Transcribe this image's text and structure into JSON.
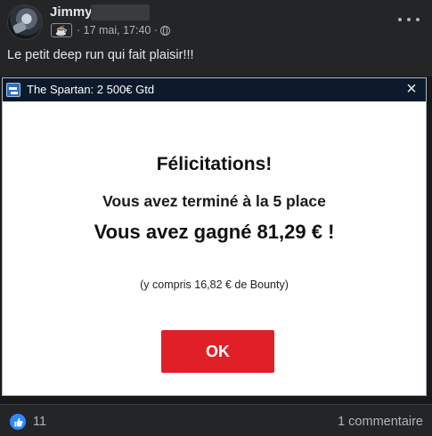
{
  "post": {
    "author_name": "Jimmy",
    "badge_icon": "coffee-cup-icon",
    "timestamp": "· 17 mai, 17:40 ·",
    "audience_icon": "globe-icon",
    "text": "Le petit deep run qui fait plaisir!!!"
  },
  "dialog": {
    "title": "The Spartan: 2 500€ Gtd",
    "close_glyph": "×",
    "heading": "Félicitations!",
    "place_text": "Vous avez terminé à la 5 place",
    "amount_text": "Vous avez gagné 81,29 € !",
    "bounty_text": "(y compris 16,82 € de Bounty)",
    "ok_label": "OK",
    "ok_color": "#e01f26",
    "titlebar_color": "#0d1a2b"
  },
  "footer": {
    "like_count": "11",
    "comments": "1 commentaire",
    "like_color": "#2e89ff"
  }
}
